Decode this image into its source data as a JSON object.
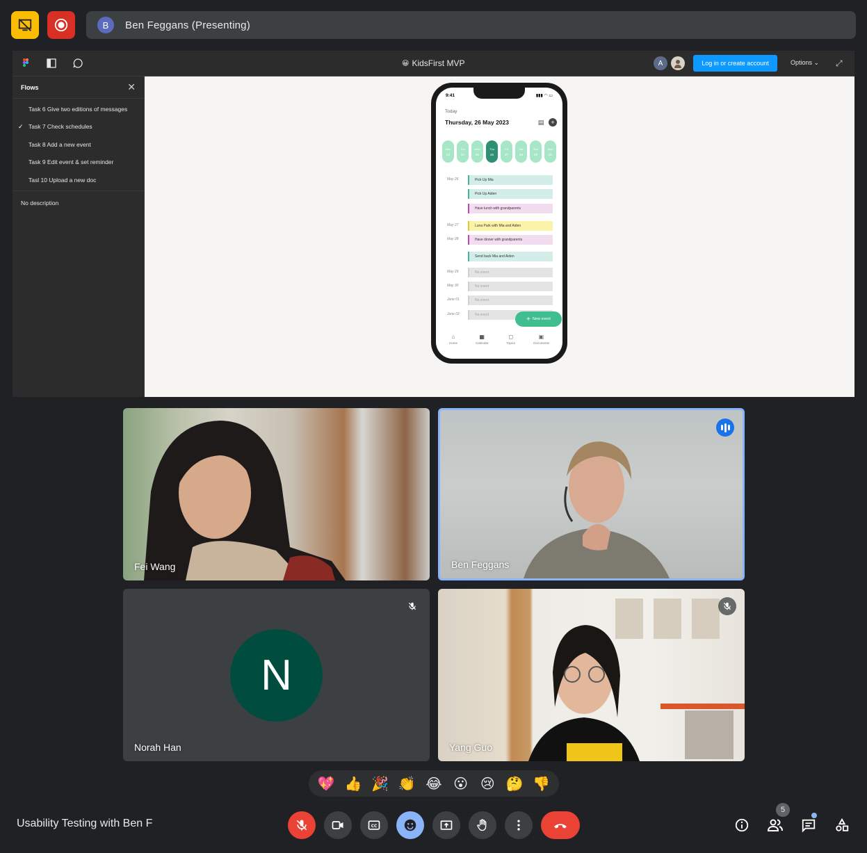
{
  "presenter": {
    "initial": "B",
    "label": "Ben Feggans (Presenting)"
  },
  "figma": {
    "file_title": "KidsFirst MVP",
    "file_emoji": "😀",
    "collab_initial": "A",
    "login_label": "Log in or create account",
    "options_label": "Options ⌄",
    "flows_title": "Flows",
    "flows": [
      "Task 6 Give two editions of messages",
      "Task 7 Check schedules",
      "Task 8 Add a new event",
      "Task 9 Edit event & set reminder",
      "Tasl 10 Upload a new doc"
    ],
    "active_flow_index": 1,
    "description": "No description"
  },
  "phone": {
    "time": "9:41",
    "today_label": "Today",
    "date_label": "Thursday, 26 May 2023",
    "week_days": [
      {
        "d": "Mon",
        "n": "23"
      },
      {
        "d": "Tue",
        "n": "24"
      },
      {
        "d": "Wed",
        "n": "25"
      },
      {
        "d": "Thu",
        "n": "26"
      },
      {
        "d": "Fri",
        "n": "27"
      },
      {
        "d": "Sat",
        "n": "28"
      },
      {
        "d": "Sun",
        "n": "29"
      },
      {
        "d": "Mon",
        "n": "30"
      }
    ],
    "agenda": [
      {
        "date": "May 26",
        "event": "Pick Up Mia",
        "style": "teal"
      },
      {
        "date": "",
        "event": "Pick Up Aiden",
        "style": "teal"
      },
      {
        "date": "",
        "event": "Have lunch with grandparents",
        "style": "pink"
      },
      {
        "date": "May 27",
        "event": "Luna Park with Mia and Aiden",
        "style": "yellow"
      },
      {
        "date": "May 28",
        "event": "Have dinner with grandparents",
        "style": "pink"
      },
      {
        "date": "",
        "event": "Send back Mia and Aiden",
        "style": "teal"
      },
      {
        "date": "May 29",
        "event": "No event",
        "style": "none"
      },
      {
        "date": "May 30",
        "event": "No event",
        "style": "none"
      },
      {
        "date": "June 01",
        "event": "No event",
        "style": "none"
      },
      {
        "date": "June 02",
        "event": "No event",
        "style": "none"
      }
    ],
    "new_event_label": "New event",
    "tabs": [
      "Home",
      "Calendar",
      "Topics",
      "Documents"
    ]
  },
  "participants": {
    "fei": "Fei Wang",
    "ben": "Ben Feggans",
    "norah": "Norah Han",
    "norah_initial": "N",
    "yang": "Yang Guo"
  },
  "reactions": [
    "💖",
    "👍",
    "🎉",
    "👏",
    "😂",
    "😮",
    "😢",
    "🤔",
    "👎"
  ],
  "meeting_title": "Usability Testing with Ben F",
  "people_count": "5"
}
